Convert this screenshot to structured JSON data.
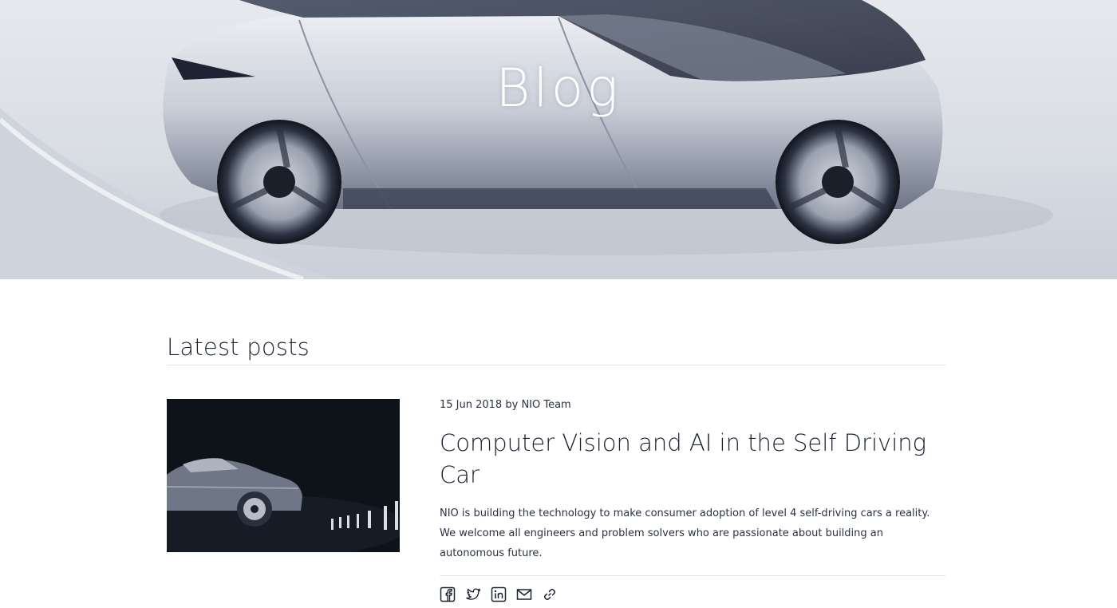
{
  "hero": {
    "title": "Blog"
  },
  "latest": {
    "heading": "Latest posts"
  },
  "post": {
    "date": "15 Jun 2018",
    "by": "by",
    "author": "NIO Team",
    "title": "Computer Vision and AI in the Self Driving Car",
    "excerpt": "NIO is building the technology to make consumer adoption of level 4 self-driving cars a reality. We welcome all engineers and problem solvers who are passionate about building an autonomous future."
  },
  "share": {
    "icons": [
      "facebook-icon",
      "twitter-icon",
      "linkedin-icon",
      "email-icon",
      "link-icon"
    ]
  },
  "colors": {
    "text": "#1b2330",
    "icon": "#1b2330",
    "rule": "#e4e6ea",
    "thumb_bg": "#0e131a"
  }
}
